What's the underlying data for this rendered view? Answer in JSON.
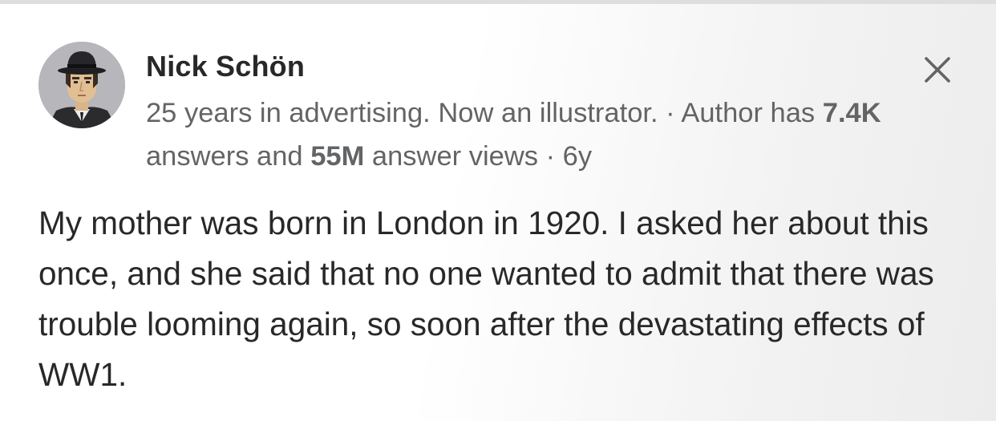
{
  "author": {
    "name": "Nick Schön",
    "credential": "25 years in advertising. Now an illustrator.",
    "separator": " · ",
    "stats_prefix": "Author has ",
    "answers_count": "7.4K",
    "answers_label": " answers and ",
    "views_count": "55M",
    "views_label": " answer views",
    "age": "6y"
  },
  "answer": {
    "text": "My mother was born in London in 1920. I asked her about this once, and she said that no one wanted to admit that there was trouble looming again, so soon after the devastating effects of WW1."
  },
  "icons": {
    "avatar": "avatar-illustration-man-in-hat",
    "close": "close-icon"
  },
  "colors": {
    "text_primary": "#282829",
    "text_secondary": "#636466",
    "icon": "#636466"
  }
}
